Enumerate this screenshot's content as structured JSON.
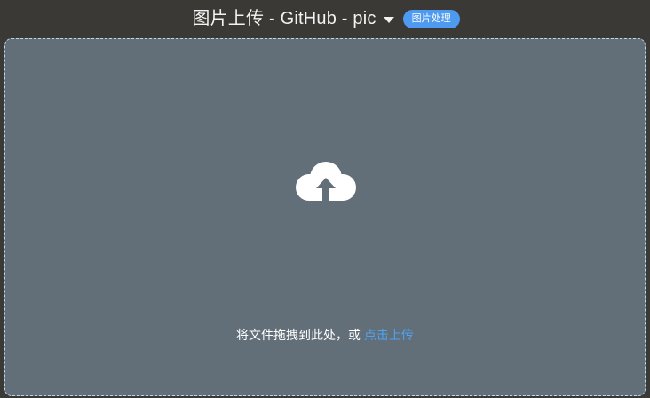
{
  "header": {
    "title": "图片上传 - GitHub - pic",
    "badge_label": "图片处理"
  },
  "dropzone": {
    "icon": "cloud-upload-icon",
    "hint_text": "将文件拖拽到此处，或 ",
    "hint_link": "点击上传"
  },
  "colors": {
    "background": "#3b3935",
    "dropzone_bg": "#626e78",
    "dropzone_border": "#b8d8ec",
    "accent": "#4e9af1",
    "link": "#4ea4f2"
  }
}
